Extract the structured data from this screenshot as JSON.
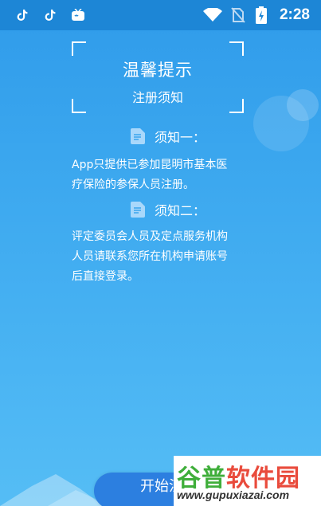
{
  "status_bar": {
    "time": "2:28",
    "left_icons": [
      "tiktok-icon",
      "tiktok-icon",
      "tv-app-icon"
    ],
    "right_icons": [
      "wifi-icon",
      "no-sim-icon",
      "battery-charging-icon"
    ]
  },
  "header": {
    "title": "温馨提示",
    "subtitle": "注册须知"
  },
  "notices": [
    {
      "heading": "须知一：",
      "lines": [
        "App只提供已参加昆明市基本医",
        "疗保险的参保人员注册。"
      ]
    },
    {
      "heading": "须知二：",
      "lines": [
        "评定委员会人员及定点服务机构",
        "人员请联系您所在机构申请账号",
        "后直接登录。"
      ]
    }
  ],
  "start_button": {
    "label": "开始注"
  },
  "watermark": {
    "text_green": "谷普",
    "text_red": "软件园",
    "url": "www.gupuxiazai.com"
  },
  "colors": {
    "status_bar": "#1d86d6",
    "background_top": "#2f9bea",
    "background_bottom": "#55bdf5",
    "button": "#2c7fe0",
    "watermark_green": "#3fae3a",
    "watermark_red": "#e94b3c"
  }
}
